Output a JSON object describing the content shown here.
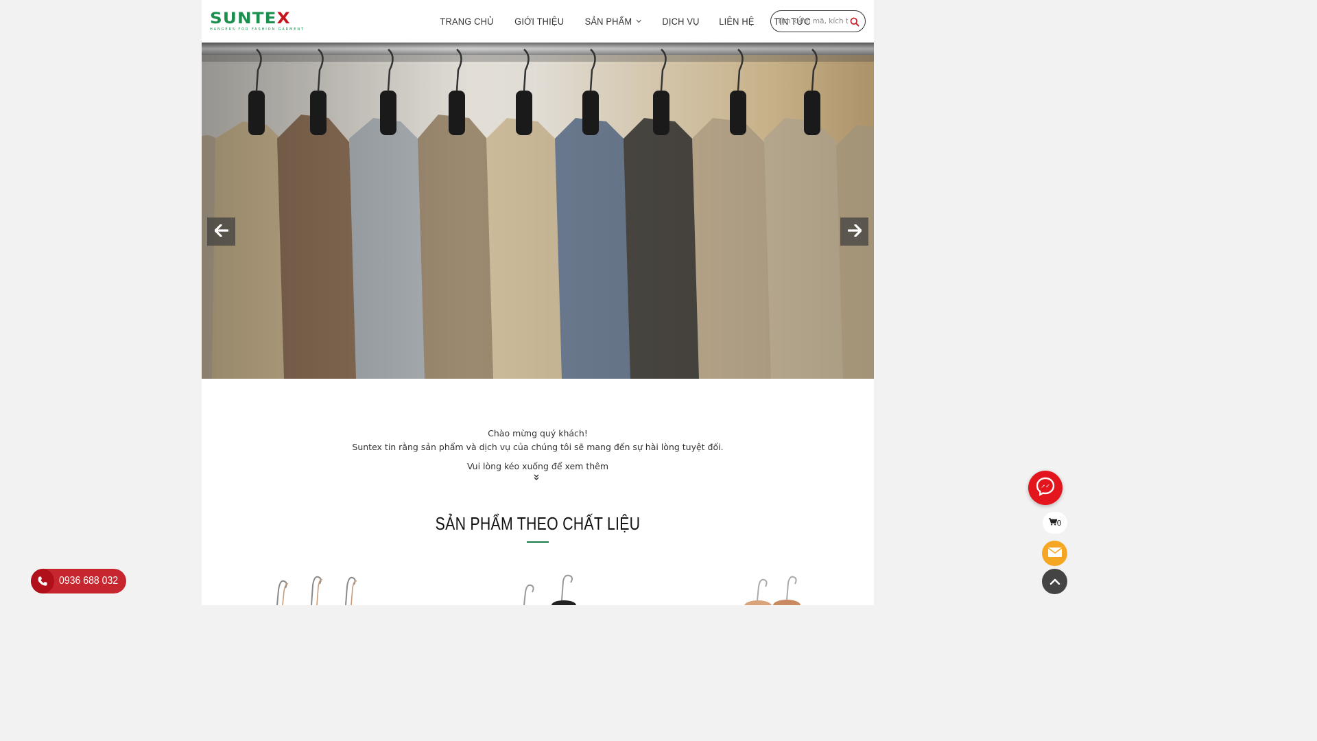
{
  "header": {
    "logo_text_main": "SUNTE",
    "logo_text_x": "X",
    "logo_tagline": "HANGERS FOR FASHION GARMENT",
    "nav": [
      {
        "label": "TRANG CHỦ"
      },
      {
        "label": "GIỚI THIỆU"
      },
      {
        "label": "SẢN PHẨM"
      },
      {
        "label": "DỊCH VỤ"
      },
      {
        "label": "LIÊN HỆ"
      },
      {
        "label": "TIN TỨC"
      }
    ],
    "search_placeholder": "Tìm kiếm mã, kích thước..."
  },
  "welcome": {
    "line1": "Chào mừng quý khách!",
    "line2": "Suntex tin rằng sản phẩm và dịch vụ của chúng tôi sẽ mang đến sự hài lòng tuyệt đối.",
    "line3": "Vui lòng kéo xuống để xem thêm"
  },
  "section": {
    "title": "SẢN PHẨM THEO CHẤT LIỆU"
  },
  "floating": {
    "phone": "0936 688 032",
    "cart_count": "0"
  },
  "colors": {
    "brand_green": "#1a8f4e",
    "brand_red": "#c8262f",
    "messenger_red": "#e2161c",
    "mail_orange": "#f5a623"
  }
}
